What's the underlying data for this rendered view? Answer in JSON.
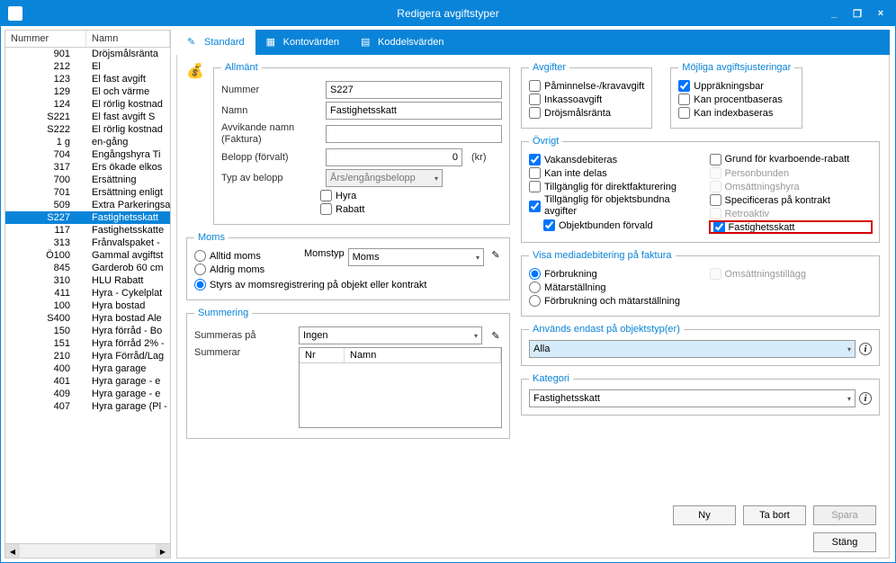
{
  "window": {
    "title": "Redigera avgiftstyper",
    "min": "_",
    "restore": "❐",
    "close": "×"
  },
  "tabs": {
    "standard": "Standard",
    "konto": "Kontovärden",
    "koddel": "Koddelsvärden"
  },
  "listHeader": {
    "num": "Nummer",
    "name": "Namn"
  },
  "listRows": [
    {
      "num": "901",
      "name": "Dröjsmålsränta"
    },
    {
      "num": "212",
      "name": "El"
    },
    {
      "num": "123",
      "name": "El  fast avgift"
    },
    {
      "num": "129",
      "name": "El  och värme"
    },
    {
      "num": "124",
      "name": "El  rörlig kostnad"
    },
    {
      "num": "S221",
      "name": "El fast avgift  S"
    },
    {
      "num": "S222",
      "name": "El rörlig kostnad"
    },
    {
      "num": "1 g",
      "name": "en-gång"
    },
    {
      "num": "704",
      "name": "Engångshyra Ti"
    },
    {
      "num": "317",
      "name": "Ers ökade elkos"
    },
    {
      "num": "700",
      "name": "Ersättning"
    },
    {
      "num": "701",
      "name": "Ersättning enligt"
    },
    {
      "num": "509",
      "name": "Extra Parkeringsavgift"
    },
    {
      "num": "S227",
      "name": "Fastighetsskatt",
      "selected": true
    },
    {
      "num": "117",
      "name": "Fastighetsskatte"
    },
    {
      "num": "313",
      "name": "Frånvalspaket -"
    },
    {
      "num": "Ö100",
      "name": "Gammal avgiftst"
    },
    {
      "num": "845",
      "name": "Garderob 60 cm"
    },
    {
      "num": "310",
      "name": "HLU Rabatt"
    },
    {
      "num": "411",
      "name": "Hyra - Cykelplat"
    },
    {
      "num": "100",
      "name": "Hyra bostad"
    },
    {
      "num": "S400",
      "name": "Hyra bostad Ale"
    },
    {
      "num": "150",
      "name": "Hyra förråd - Bo"
    },
    {
      "num": "151",
      "name": "Hyra förråd 2% -"
    },
    {
      "num": "210",
      "name": "Hyra Förråd/Lag"
    },
    {
      "num": "400",
      "name": "Hyra garage"
    },
    {
      "num": "401",
      "name": "Hyra garage - e"
    },
    {
      "num": "409",
      "name": "Hyra garage - e"
    },
    {
      "num": "407",
      "name": "Hyra garage (Pl -"
    }
  ],
  "allmant": {
    "legend": "Allmänt",
    "nummer_lbl": "Nummer",
    "nummer_val": "S227",
    "namn_lbl": "Namn",
    "namn_val": "Fastighetsskatt",
    "avvik_lbl": "Avvikande namn (Faktura)",
    "avvik_val": "",
    "belopp_lbl": "Belopp (förvalt)",
    "belopp_val": "0",
    "kr": "(kr)",
    "typ_lbl": "Typ av belopp",
    "typ_val": "Års/engångsbelopp",
    "hyra": "Hyra",
    "rabatt": "Rabatt"
  },
  "moms": {
    "legend": "Moms",
    "alltid": "Alltid moms",
    "aldrig": "Aldrig moms",
    "styrs": "Styrs av momsregistrering på objekt eller kontrakt",
    "momstyp_lbl": "Momstyp",
    "momstyp_val": "Moms"
  },
  "summ": {
    "legend": "Summering",
    "summeras_lbl": "Summeras på",
    "summeras_val": "Ingen",
    "summerar_lbl": "Summerar",
    "nr": "Nr",
    "namn": "Namn"
  },
  "avgifter": {
    "legend": "Avgifter",
    "paminnelse": "Påminnelse-/kravavgift",
    "inkasso": "Inkassoavgift",
    "drojsmal": "Dröjsmålsränta"
  },
  "just": {
    "legend": "Möjliga avgiftsjusteringar",
    "upprakn": "Uppräkningsbar",
    "procent": "Kan procentbaseras",
    "index": "Kan indexbaseras"
  },
  "ovrigt": {
    "legend": "Övrigt",
    "vakans": "Vakansdebiteras",
    "kan_inte": "Kan inte delas",
    "direkt": "Tillgänglig för direktfakturering",
    "tillg_obj": "Tillgänglig för objektsbundna avgifter",
    "obj_forvald": "Objektbunden förvald",
    "grund": "Grund för kvarboende-rabatt",
    "personbunden": "Personbunden",
    "omsattnings": "Omsättningshyra",
    "specificeras": "Specificeras på kontrakt",
    "retroaktiv": "Retroaktiv",
    "fastighetsskatt": "Fastighetsskatt"
  },
  "media": {
    "legend": "Visa mediadebitering på faktura",
    "forbrukning": "Förbrukning",
    "matarstallning": "Mätarställning",
    "forbr_mat": "Förbrukning och mätarställning",
    "omsatt": "Omsättningstillägg"
  },
  "anvands": {
    "legend": "Används endast på objektstyp(er)",
    "val": "Alla"
  },
  "kategori": {
    "legend": "Kategori",
    "val": "Fastighetsskatt"
  },
  "buttons": {
    "ny": "Ny",
    "tabort": "Ta bort",
    "spara": "Spara",
    "stang": "Stäng"
  }
}
